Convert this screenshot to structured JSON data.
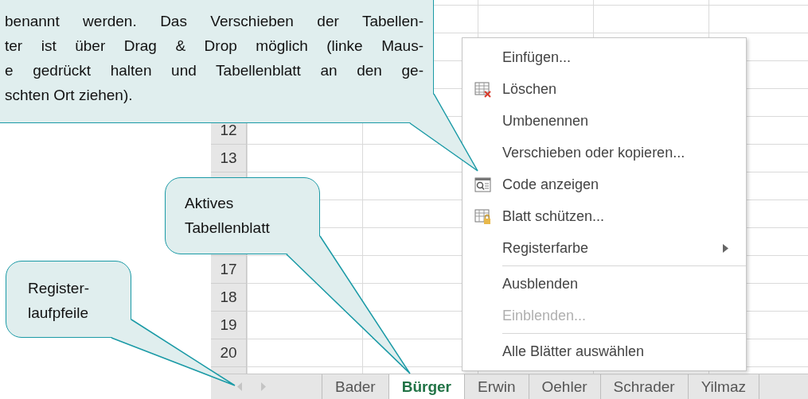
{
  "callouts": [
    {
      "kind": "note",
      "lines": [
        "benannt werden. Das Verschieben der Tabellen-",
        "ter ist über Drag & Drop möglich (linke Maus-",
        "e gedrückt halten und Tabellenblatt an den ge-",
        "schten Ort ziehen)."
      ]
    },
    {
      "kind": "active-sheet",
      "lines": [
        "Aktives",
        "Tabellenblatt"
      ]
    },
    {
      "kind": "scroll-arrows",
      "lines": [
        "Register-",
        "laufpfeile"
      ]
    }
  ],
  "sheet": {
    "row_headers": [
      "12",
      "13",
      "17",
      "18",
      "19",
      "20"
    ]
  },
  "context_menu": {
    "items": [
      {
        "kind": "item",
        "label": "Einfügen...",
        "disabled": false,
        "submenu": false
      },
      {
        "kind": "item",
        "label": "Löschen",
        "disabled": false,
        "submenu": false
      },
      {
        "kind": "item",
        "label": "Umbenennen",
        "disabled": false,
        "submenu": false
      },
      {
        "kind": "item",
        "label": "Verschieben oder kopieren...",
        "disabled": false,
        "submenu": false
      },
      {
        "kind": "item",
        "label": "Code anzeigen",
        "disabled": false,
        "submenu": false
      },
      {
        "kind": "item",
        "label": "Blatt schützen...",
        "disabled": false,
        "submenu": false
      },
      {
        "kind": "item",
        "label": "Registerfarbe",
        "disabled": false,
        "submenu": true
      },
      {
        "kind": "separator"
      },
      {
        "kind": "item",
        "label": "Ausblenden",
        "disabled": false,
        "submenu": false
      },
      {
        "kind": "item",
        "label": "Einblenden...",
        "disabled": true,
        "submenu": false
      },
      {
        "kind": "separator"
      },
      {
        "kind": "item",
        "label": "Alle Blätter auswählen",
        "disabled": false,
        "submenu": false
      }
    ]
  },
  "sheet_tabs": [
    {
      "label": "Bader",
      "selected": false
    },
    {
      "label": "Bürger",
      "selected": true
    },
    {
      "label": "Erwin",
      "selected": false
    },
    {
      "label": "Oehler",
      "selected": false
    },
    {
      "label": "Schrader",
      "selected": false
    },
    {
      "label": "Yilmaz",
      "selected": false
    }
  ]
}
